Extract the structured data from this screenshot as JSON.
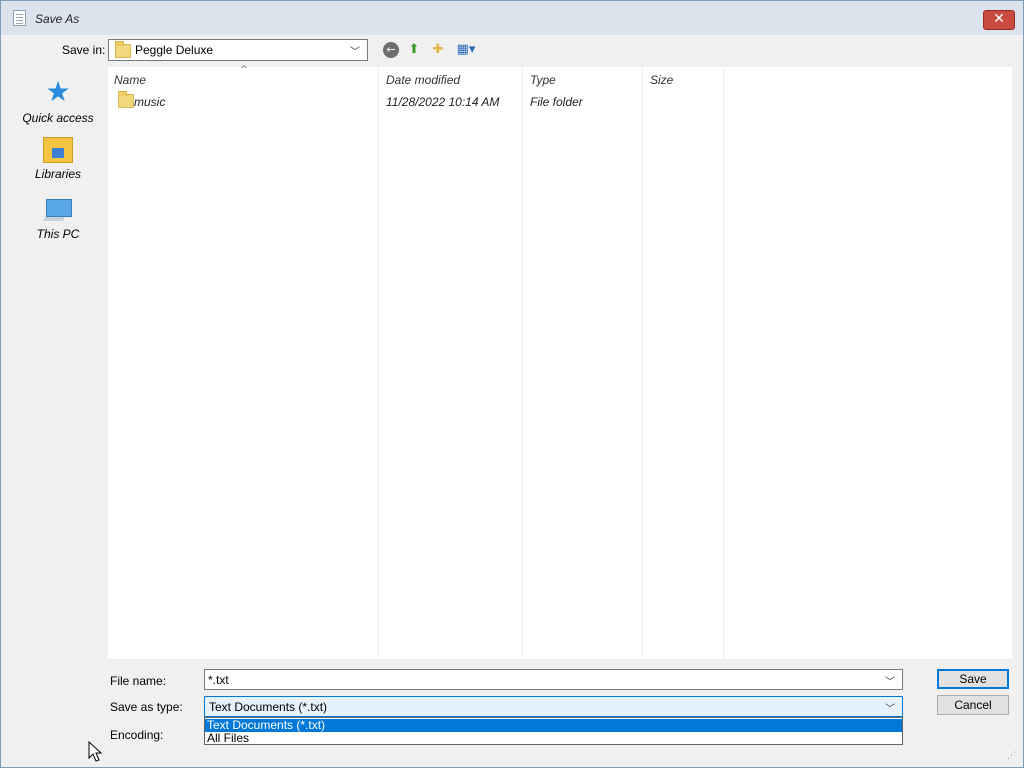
{
  "window": {
    "title": "Save As",
    "close_glyph": "✕"
  },
  "toolbar": {
    "save_in_label": "Save in:",
    "save_in_value": "Peggle Deluxe",
    "icons": [
      "back-icon",
      "up-folder-icon",
      "new-folder-icon",
      "view-menu-icon"
    ]
  },
  "places": [
    {
      "label": "Quick access",
      "icon": "star-icon"
    },
    {
      "label": "Libraries",
      "icon": "libraries-icon"
    },
    {
      "label": "This PC",
      "icon": "computer-icon"
    }
  ],
  "file_list": {
    "columns": [
      "Name",
      "Date modified",
      "Type",
      "Size"
    ],
    "rows": [
      {
        "name": "music",
        "date_modified": "11/28/2022 10:14 AM",
        "type": "File folder",
        "size": ""
      }
    ]
  },
  "form": {
    "file_name_label": "File name:",
    "file_name_value": "*.txt",
    "save_as_type_label": "Save as type:",
    "save_as_type_value": "Text Documents (*.txt)",
    "encoding_label": "Encoding:",
    "type_options": [
      "Text Documents (*.txt)",
      "All Files"
    ],
    "selected_option_index": 0
  },
  "buttons": {
    "save": "Save",
    "cancel": "Cancel"
  },
  "colors": {
    "accent": "#0078d7",
    "close": "#c94b3f"
  }
}
